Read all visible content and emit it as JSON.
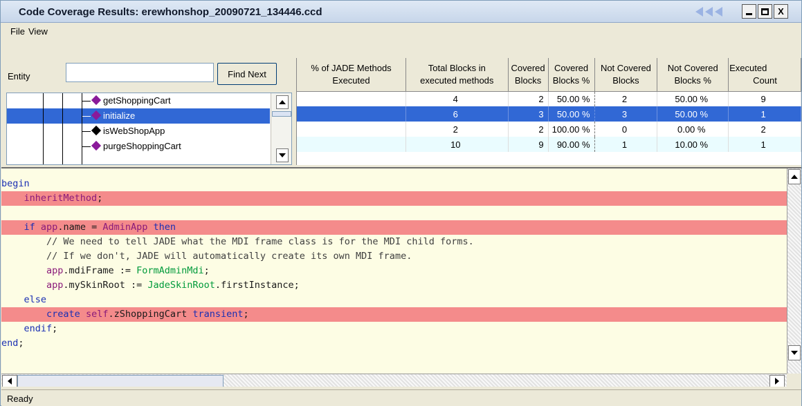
{
  "window": {
    "title": "Code Coverage Results: erewhonshop_20090721_134446.ccd",
    "minimize": "_",
    "maximize": "□",
    "close": "X"
  },
  "menu": {
    "items": [
      "File",
      "View"
    ]
  },
  "entity": {
    "label": "Entity",
    "input_value": "",
    "find_next": "Find Next"
  },
  "tree": {
    "items": [
      {
        "label": "getShoppingCart",
        "icon": "purple-diamond-method-icon",
        "color": "#8a1a9a"
      },
      {
        "label": "initialize",
        "icon": "purple-diamond-method-icon",
        "color": "#8a1a9a",
        "selected": true
      },
      {
        "label": "isWebShopApp",
        "icon": "black-diamond-method-icon",
        "color": "#000000"
      },
      {
        "label": "purgeShoppingCart",
        "icon": "purple-diamond-method-icon",
        "color": "#8a1a9a"
      }
    ]
  },
  "grid": {
    "headers": [
      [
        "% of JADE Methods",
        "Executed"
      ],
      [
        "Total Blocks in",
        "executed methods"
      ],
      [
        "Covered",
        "Blocks"
      ],
      [
        "Covered",
        "Blocks %"
      ],
      [
        "Not Covered",
        "Blocks"
      ],
      [
        "Not Covered",
        "Blocks %"
      ],
      [
        "Executed",
        "Count"
      ]
    ],
    "rows": [
      [
        "",
        "4",
        "2",
        "50.00 %",
        "2",
        "50.00 %",
        "9"
      ],
      [
        "",
        "6",
        "3",
        "50.00 %",
        "3",
        "50.00 %",
        "1"
      ],
      [
        "",
        "2",
        "2",
        "100.00 %",
        "0",
        "0.00 %",
        "2"
      ],
      [
        "",
        "10",
        "9",
        "90.00 %",
        "1",
        "10.00 %",
        "1"
      ]
    ]
  },
  "code": {
    "lines": [
      {
        "text": "begin",
        "highlight": false
      },
      {
        "text": "    inheritMethod;",
        "highlight": true
      },
      {
        "text": "",
        "highlight": false
      },
      {
        "text": "    if app.name = AdminApp then",
        "highlight": true
      },
      {
        "text": "        // We need to tell JADE what the MDI frame class is for the MDI child forms.",
        "highlight": false
      },
      {
        "text": "        // If we don't, JADE will automatically create its own MDI frame.",
        "highlight": false
      },
      {
        "text": "        app.mdiFrame := FormAdminMdi;",
        "highlight": false
      },
      {
        "text": "        app.mySkinRoot := JadeSkinRoot.firstInstance;",
        "highlight": false
      },
      {
        "text": "    else",
        "highlight": false
      },
      {
        "text": "        create self.zShoppingCart transient;",
        "highlight": true
      },
      {
        "text": "    endif;",
        "highlight": false
      },
      {
        "text": "end;",
        "highlight": false
      }
    ],
    "highlight_color": "#f48b8b",
    "background_color": "#fdfde4"
  },
  "status": {
    "text": "Ready"
  }
}
